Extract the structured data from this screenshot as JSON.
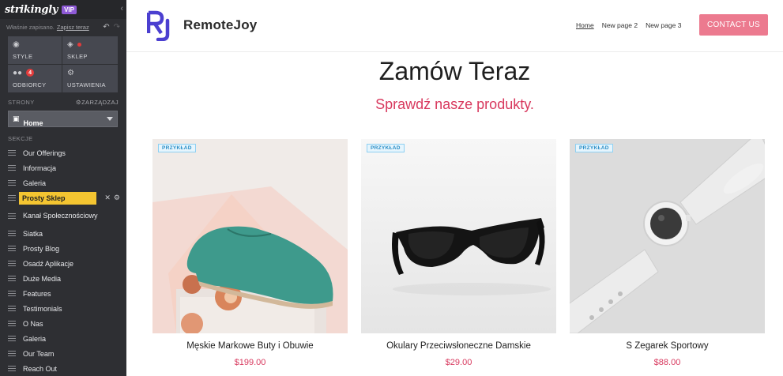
{
  "editor": {
    "logo": "strikingly",
    "vip": "VIP",
    "save_status": "Właśnie zapisano.",
    "save_now": "Zapisz teraz",
    "buttons": {
      "style": "STYLE",
      "shop": "SKLEP",
      "audience": "ODBIORCY",
      "audience_badge": "4",
      "settings": "USTAWIENIA"
    },
    "pages_label": "STRONY",
    "manage_label": "ZARZĄDZAJ",
    "current_page": "Home",
    "sections_label": "SEKCJE",
    "sections": [
      "Our Offerings",
      "Informacja",
      "Galeria",
      "Prosty Sklep",
      "Kanał Społecznościowy",
      "Siatka",
      "Prosty Blog",
      "Osadź Aplikacje",
      "Duże Media",
      "Features",
      "Testimonials",
      "O Nas",
      "Galeria",
      "Our Team",
      "Reach Out"
    ],
    "active_section_index": 3
  },
  "site": {
    "brand_mark": "RJ",
    "brand_name": "RemoteJoy",
    "nav": [
      "Home",
      "New page 2",
      "New page 3"
    ],
    "contact_button": "CONTACT US",
    "title": "Zamów Teraz",
    "subtitle": "Sprawdź nasze produkty.",
    "products": [
      {
        "tag": "PRZYKŁAD",
        "name": "Męskie Markowe Buty i Obuwie",
        "price": "$199.00"
      },
      {
        "tag": "PRZYKŁAD",
        "name": "Okulary Przeciwsłoneczne Damskie",
        "price": "$29.00"
      },
      {
        "tag": "PRZYKŁAD",
        "name": "S Zegarek Sportowy",
        "price": "$88.00"
      }
    ]
  },
  "colors": {
    "sidebar_bg": "#2e2f33",
    "vip": "#8e5ad6",
    "active_section": "#f4c531",
    "accent_pink": "#ec7a8f",
    "accent_red": "#d8395e",
    "brand_purple": "#4b3fd0",
    "tag_blue": "#2a8ec6"
  }
}
